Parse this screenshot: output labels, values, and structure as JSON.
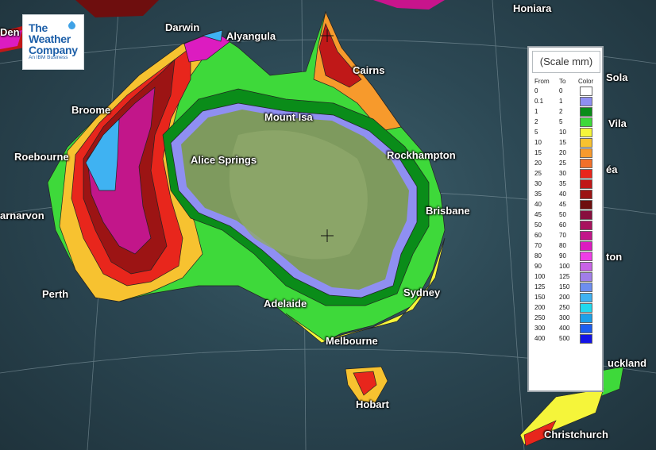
{
  "logo": {
    "line1": "The",
    "line2": "Weather",
    "line3": "Company",
    "tagline": "An IBM Business"
  },
  "cities": [
    {
      "id": "darwin",
      "name": "Darwin"
    },
    {
      "id": "alyangula",
      "name": "Alyangula"
    },
    {
      "id": "honiara",
      "name": "Honiara"
    },
    {
      "id": "den",
      "name": "Den"
    },
    {
      "id": "cairns",
      "name": "Cairns"
    },
    {
      "id": "broome",
      "name": "Broome"
    },
    {
      "id": "mount-isa",
      "name": "Mount Isa"
    },
    {
      "id": "roebourne",
      "name": "Roebourne"
    },
    {
      "id": "alice-springs",
      "name": "Alice Springs"
    },
    {
      "id": "rockhampton",
      "name": "Rockhampton"
    },
    {
      "id": "carnarvon",
      "name": "arnarvon"
    },
    {
      "id": "brisbane",
      "name": "Brisbane"
    },
    {
      "id": "perth",
      "name": "Perth"
    },
    {
      "id": "adelaide",
      "name": "Adelaide"
    },
    {
      "id": "sydney",
      "name": "Sydney"
    },
    {
      "id": "melbourne",
      "name": "Melbourne"
    },
    {
      "id": "hobart",
      "name": "Hobart"
    },
    {
      "id": "auckland",
      "name": "uckland"
    },
    {
      "id": "christchurch",
      "name": "Christchurch"
    },
    {
      "id": "sola",
      "name": "Sola"
    },
    {
      "id": "vila",
      "name": "Vila"
    },
    {
      "id": "nea",
      "name": "éa"
    },
    {
      "id": "ton",
      "name": "ton"
    }
  ],
  "legend": {
    "title": "(Scale mm)",
    "col_from": "From",
    "col_to": "To",
    "col_color": "Color",
    "rows": [
      {
        "from": "0",
        "to": "0",
        "color": "#ffffff"
      },
      {
        "from": "0.1",
        "to": "1",
        "color": "#8f8ff2"
      },
      {
        "from": "1",
        "to": "2",
        "color": "#0a8c19"
      },
      {
        "from": "2",
        "to": "5",
        "color": "#3ed93a"
      },
      {
        "from": "5",
        "to": "10",
        "color": "#f5f53a"
      },
      {
        "from": "10",
        "to": "15",
        "color": "#f7c230"
      },
      {
        "from": "15",
        "to": "20",
        "color": "#f79a2c"
      },
      {
        "from": "20",
        "to": "25",
        "color": "#f2702a"
      },
      {
        "from": "25",
        "to": "30",
        "color": "#e8261c"
      },
      {
        "from": "30",
        "to": "35",
        "color": "#c01818"
      },
      {
        "from": "35",
        "to": "40",
        "color": "#9c1414"
      },
      {
        "from": "40",
        "to": "45",
        "color": "#6e0e0e"
      },
      {
        "from": "45",
        "to": "50",
        "color": "#880e3e"
      },
      {
        "from": "50",
        "to": "60",
        "color": "#a8125e"
      },
      {
        "from": "60",
        "to": "70",
        "color": "#c2168a"
      },
      {
        "from": "70",
        "to": "80",
        "color": "#dc1cc0"
      },
      {
        "from": "80",
        "to": "90",
        "color": "#ee3ee6"
      },
      {
        "from": "90",
        "to": "100",
        "color": "#c864e6"
      },
      {
        "from": "100",
        "to": "125",
        "color": "#a17ee8"
      },
      {
        "from": "125",
        "to": "150",
        "color": "#6d8ef0"
      },
      {
        "from": "150",
        "to": "200",
        "color": "#3fb2f2"
      },
      {
        "from": "200",
        "to": "250",
        "color": "#22d8ee"
      },
      {
        "from": "250",
        "to": "300",
        "color": "#1ca0e8"
      },
      {
        "from": "300",
        "to": "400",
        "color": "#1c5ef0"
      },
      {
        "from": "400",
        "to": "500",
        "color": "#1414e6"
      }
    ]
  }
}
